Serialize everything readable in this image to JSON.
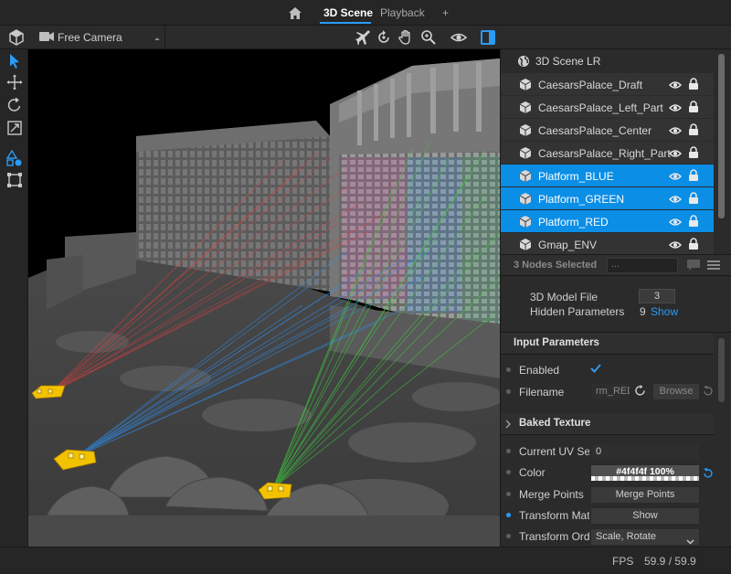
{
  "tabs": {
    "home_icon": "home-icon",
    "active": "3D Scene",
    "other": "Playback",
    "add": "+"
  },
  "viewport_toolbar": {
    "camera_label": "Free Camera",
    "tools": [
      "plane-icon",
      "orbit-icon",
      "pan-hand-icon",
      "zoom-icon",
      "eye-icon",
      "panel-toggle-icon"
    ]
  },
  "left_tools": [
    "select-arrow-icon",
    "move-icon",
    "rotate-icon",
    "scale-icon",
    "shapes-icon",
    "bounding-box-icon"
  ],
  "scene_tree": {
    "root": "3D Scene LR",
    "nodes": [
      {
        "label": "CaesarsPalace_Draft",
        "selected": false
      },
      {
        "label": "CaesarsPalace_Left_Part",
        "selected": false
      },
      {
        "label": "CaesarsPalace_Center",
        "selected": false
      },
      {
        "label": "CaesarsPalace_Right_Part",
        "selected": false
      },
      {
        "label": "Platform_BLUE",
        "selected": true
      },
      {
        "label": "Platform_GREEN",
        "selected": true
      },
      {
        "label": "Platform_RED",
        "selected": true
      },
      {
        "label": "Gmap_ENV",
        "selected": false
      }
    ]
  },
  "nodes_bar": {
    "label": "3 Nodes Selected",
    "search_value": "..."
  },
  "info": {
    "model_file_label": "3D Model File",
    "model_file_value": "3",
    "hidden_params_label": "Hidden Parameters",
    "hidden_params_value": "9",
    "show_link": "Show"
  },
  "input_parameters": {
    "title": "Input Parameters",
    "enabled_label": "Enabled",
    "filename_label": "Filename",
    "filename_value": "rm_RED",
    "browse_label": "Browse"
  },
  "baked_texture": {
    "title": "Baked Texture",
    "uv_label": "Current UV Set",
    "uv_value": "0",
    "color_label": "Color",
    "color_value": "#4f4f4f 100%",
    "merge_label": "Merge Points",
    "merge_button": "Merge Points",
    "transform_label": "Transform Matr",
    "transform_button": "Show",
    "order_label": "Transform Orde",
    "order_value": "Scale, Rotate"
  },
  "status": {
    "fps_label": "FPS",
    "fps_value": "59.9 / 59.9"
  },
  "colors": {
    "accent": "#2b9bf4",
    "selection": "#0a8ee6",
    "panel": "#2b2b2b",
    "ray_red": "#e04040",
    "ray_green": "#3ec83e",
    "ray_blue": "#2f8ff0",
    "platform": "#f2c200"
  }
}
